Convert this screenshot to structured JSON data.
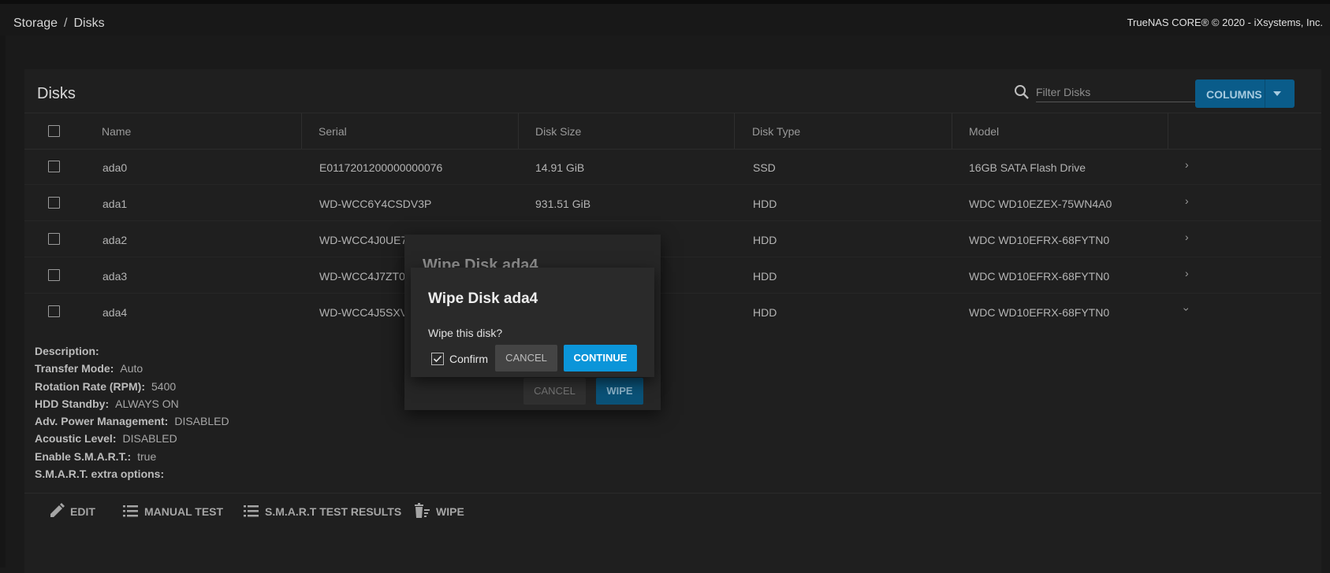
{
  "breadcrumb": {
    "parent": "Storage",
    "separator": "/",
    "current": "Disks"
  },
  "copyright": "TrueNAS CORE® © 2020 - iXsystems, Inc.",
  "card": {
    "title": "Disks",
    "search_placeholder": "Filter Disks",
    "columns_button": "COLUMNS"
  },
  "table": {
    "headers": {
      "name": "Name",
      "serial": "Serial",
      "size": "Disk Size",
      "type": "Disk Type",
      "model": "Model"
    },
    "rows": [
      {
        "name": "ada0",
        "serial": "E0117201200000000076",
        "size": "14.91 GiB",
        "type": "SSD",
        "model": "16GB SATA Flash Drive",
        "expanded": false
      },
      {
        "name": "ada1",
        "serial": "WD-WCC6Y4CSDV3P",
        "size": "931.51 GiB",
        "type": "HDD",
        "model": "WDC WD10EZEX-75WN4A0",
        "expanded": false
      },
      {
        "name": "ada2",
        "serial": "WD-WCC4J0UE7X/",
        "size": "",
        "type": "HDD",
        "model": "WDC WD10EFRX-68FYTN0",
        "expanded": false
      },
      {
        "name": "ada3",
        "serial": "WD-WCC4J7ZT0R/",
        "size": "",
        "type": "HDD",
        "model": "WDC WD10EFRX-68FYTN0",
        "expanded": false
      },
      {
        "name": "ada4",
        "serial": "WD-WCC4J5SXVE(",
        "size": "",
        "type": "HDD",
        "model": "WDC WD10EFRX-68FYTN0",
        "expanded": true
      }
    ]
  },
  "details": [
    {
      "key": "Description:",
      "value": ""
    },
    {
      "key": "Transfer Mode:",
      "value": "Auto"
    },
    {
      "key": "Rotation Rate (RPM):",
      "value": "5400"
    },
    {
      "key": "HDD Standby:",
      "value": "ALWAYS ON"
    },
    {
      "key": "Adv. Power Management:",
      "value": "DISABLED"
    },
    {
      "key": "Acoustic Level:",
      "value": "DISABLED"
    },
    {
      "key": "Enable S.M.A.R.T.:",
      "value": "true"
    },
    {
      "key": "S.M.A.R.T. extra options:",
      "value": ""
    }
  ],
  "actions": {
    "edit": "EDIT",
    "manual_test": "MANUAL TEST",
    "smart_results": "S.M.A.R.T TEST RESULTS",
    "wipe": "WIPE"
  },
  "wipe_dialog": {
    "title": "Wipe Disk ada4",
    "cancel": "CANCEL",
    "wipe": "WIPE"
  },
  "confirm_dialog": {
    "title": "Wipe Disk ada4",
    "message": "Wipe this disk?",
    "confirm_label": "Confirm",
    "confirm_checked": true,
    "cancel": "CANCEL",
    "continue": "CONTINUE"
  },
  "colors": {
    "accent": "#0b95d9",
    "columns_button": "#0a5c8a",
    "background": "#1a1a1a",
    "card": "#1f1f1f"
  }
}
